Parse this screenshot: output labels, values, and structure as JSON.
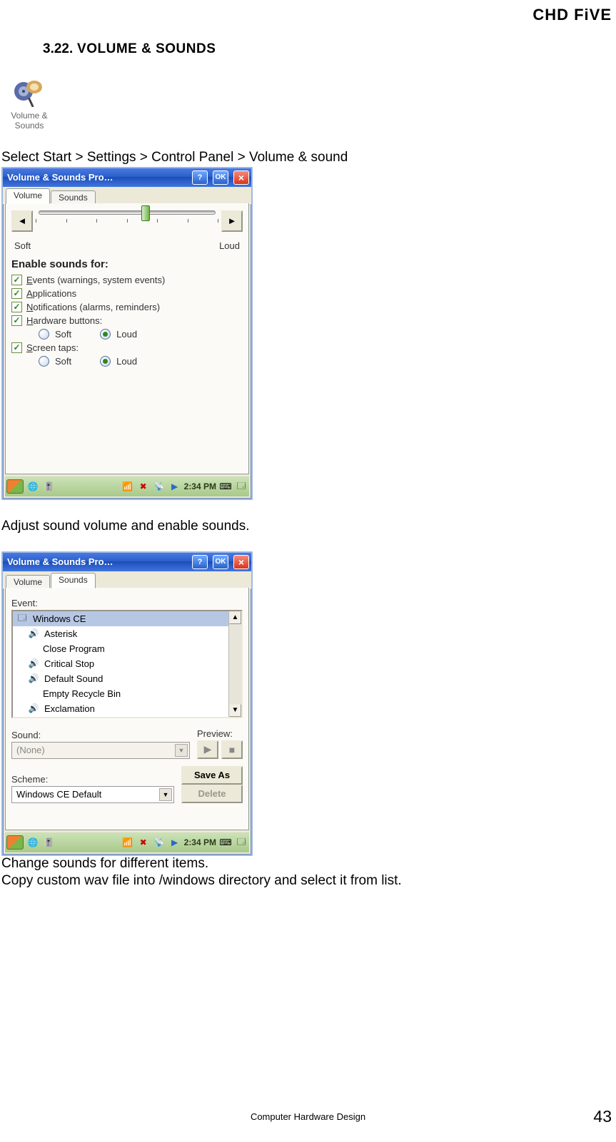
{
  "brand": "CHD FiVE",
  "section_heading": {
    "num": "3.22.",
    "title": " VOLUME & SOUNDS"
  },
  "cp_icon_label": "Volume & Sounds",
  "para1": "Select Start > Settings > Control Panel > Volume & sound",
  "para2": "Adjust sound volume and enable sounds.",
  "para3": "Change sounds for different items.",
  "para4": "Copy custom wav file into /windows directory and select it from list.",
  "footer_center": "Computer Hardware Design",
  "page_number": "43",
  "titlebar": {
    "title": "Volume & Sounds Pro…",
    "help": "?",
    "ok": "OK",
    "close": "×"
  },
  "tabs": {
    "volume": "Volume",
    "sounds": "Sounds"
  },
  "volume_tab": {
    "soft": "Soft",
    "loud": "Loud",
    "group": "Enable sounds for:",
    "events": "Events (warnings, system events)",
    "events_u": "E",
    "apps": "Applications",
    "apps_u": "A",
    "notif": "Notifications (alarms, reminders)",
    "notif_u": "N",
    "hw": "Hardware buttons:",
    "hw_u": "H",
    "taps": "Screen taps:",
    "taps_u": "S",
    "rsoft": "Soft",
    "rloud": "Loud"
  },
  "sounds_tab": {
    "event_lbl": "Event:",
    "items": {
      "i0": "Windows CE",
      "i1": "Asterisk",
      "i2": "Close Program",
      "i3": "Critical Stop",
      "i4": "Default Sound",
      "i5": "Empty Recycle Bin",
      "i6": "Exclamation"
    },
    "sound_lbl": "Sound:",
    "preview_lbl": "Preview:",
    "sound_val": "(None)",
    "scheme_lbl": "Scheme:",
    "scheme_val": "Windows CE Default",
    "saveas": "Save As",
    "delete": "Delete"
  },
  "taskbar": {
    "time": "2:34 PM"
  }
}
